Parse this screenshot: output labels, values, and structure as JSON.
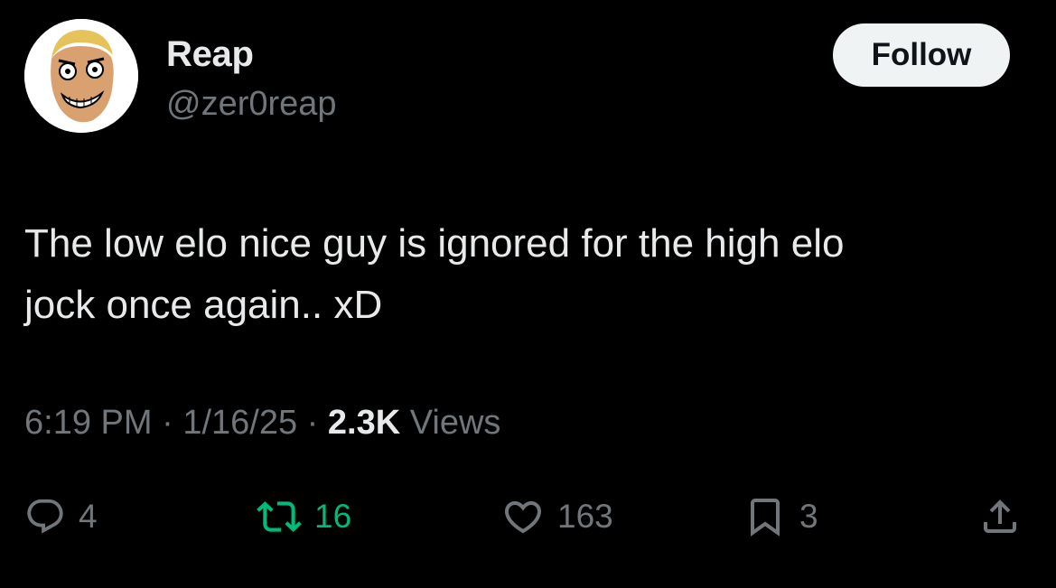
{
  "author": {
    "display_name": "Reap",
    "handle": "@zer0reap",
    "avatar_icon": "cartoon-face-avatar"
  },
  "follow_button": {
    "label": "Follow"
  },
  "tweet": {
    "text": "The low elo nice guy is ignored for the high elo\njock once again.. xD",
    "time": "6:19 PM",
    "date": "1/16/25",
    "views_count": "2.3K",
    "views_label": "Views",
    "separator": "·"
  },
  "actions": {
    "replies": {
      "icon": "reply-icon",
      "count": "4"
    },
    "retweets": {
      "icon": "retweet-icon",
      "count": "16",
      "color": "#00ba7c"
    },
    "likes": {
      "icon": "heart-icon",
      "count": "163"
    },
    "bookmarks": {
      "icon": "bookmark-icon",
      "count": "3"
    },
    "share": {
      "icon": "share-icon"
    }
  },
  "colors": {
    "background": "#000000",
    "primary_text": "#e7e9ea",
    "secondary_text": "#71767b",
    "retweet_green": "#00ba7c",
    "follow_bg": "#eff3f4"
  }
}
